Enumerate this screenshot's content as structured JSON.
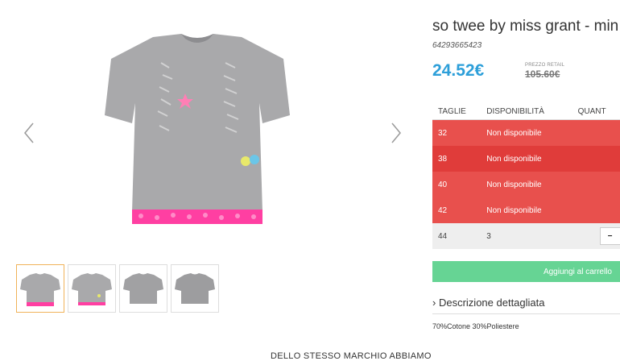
{
  "product": {
    "title": "so twee by miss grant - min",
    "sku": "64293665423",
    "price": "24.52€",
    "retail_label": "PREZZO RETAIL",
    "retail_price": "105.60€"
  },
  "gallery": {
    "prev_icon": "chevron-left-icon",
    "next_icon": "chevron-right-icon",
    "thumbnail_count": 4
  },
  "sizes": {
    "headers": [
      "TAGLIE",
      "DISPONIBILITÀ",
      "QUANT"
    ],
    "rows": [
      {
        "size": "32",
        "availability": "Non disponibile",
        "status": "unavailable"
      },
      {
        "size": "38",
        "availability": "Non disponibile",
        "status": "unavailable"
      },
      {
        "size": "40",
        "availability": "Non disponibile",
        "status": "unavailable"
      },
      {
        "size": "42",
        "availability": "Non disponibile",
        "status": "unavailable"
      },
      {
        "size": "44",
        "availability": "3",
        "status": "available",
        "quantity_control": "−"
      }
    ]
  },
  "actions": {
    "add_to_cart": "Aggiungi al carrello"
  },
  "description": {
    "header": "Descrizione dettagliata",
    "chevron": "›",
    "composition": "70%Cotone 30%Poliestere"
  },
  "footer": {
    "brand_section": "DELLO STESSO MARCHIO ABBIAMO"
  },
  "colors": {
    "price": "#2d9fd9",
    "unavailable_row": "#e8504d",
    "cart_button": "#66d494",
    "active_thumb_border": "#f0b35a"
  }
}
